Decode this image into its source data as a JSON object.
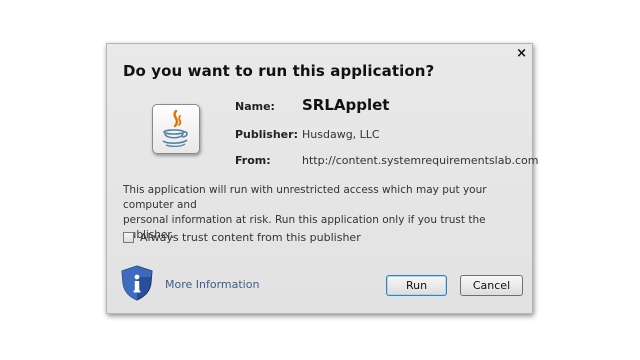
{
  "dialog": {
    "title": "Do you want to run this application?",
    "close_glyph": "×",
    "app_icon": "java-icon",
    "labels": {
      "name": "Name:",
      "publisher": "Publisher:",
      "from": "From:"
    },
    "values": {
      "name": "SRLApplet",
      "publisher": "Husdawg, LLC",
      "from": "http://content.systemrequirementslab.com"
    },
    "warning_line1": "This application will run with unrestricted access which may put your computer and",
    "warning_line2": "personal information at risk. Run this application only if you trust the publisher.",
    "checkbox_label": "Always trust content from this publisher",
    "checkbox_checked": false,
    "shield_icon": "shield-info-icon",
    "more_info_link": "More Information",
    "run_button": "Run",
    "cancel_button": "Cancel"
  },
  "colors": {
    "dialog_bg": "#e6e6e6",
    "link": "#3b5f8a",
    "shield_blue": "#2a4f9a",
    "java_orange": "#e76f00",
    "java_blue": "#5382a1"
  }
}
